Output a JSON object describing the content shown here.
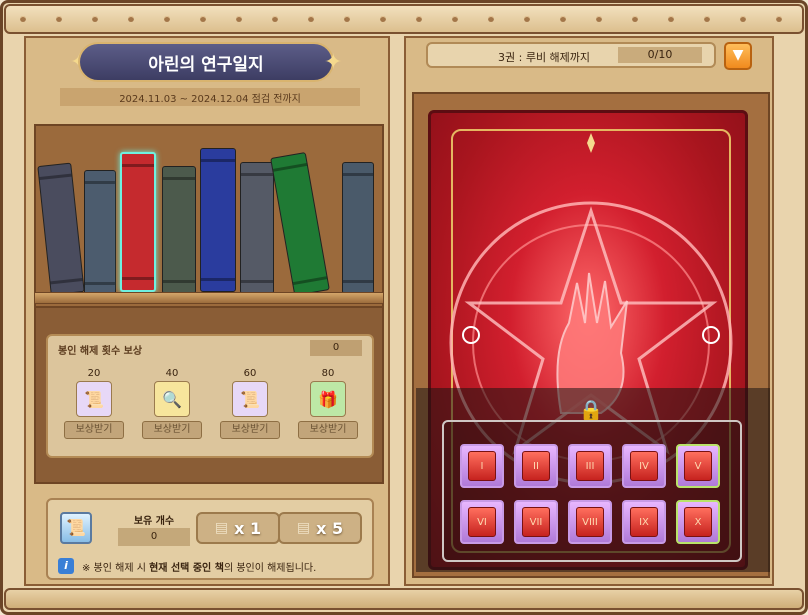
{
  "title": "아린의 연구일지",
  "period": "2024.11.03 ~ 2024.12.04 점검 전까지",
  "progress": {
    "label": "3권 : 루비 해제까지",
    "value": "0/10",
    "dropdown_icon": "chevron-down-icon"
  },
  "books": [
    {
      "color": "#4a4c5e",
      "selected": false
    },
    {
      "color": "#4c5c6e",
      "selected": false
    },
    {
      "color": "#c52a2e",
      "selected": true
    },
    {
      "color": "#4c5a4c",
      "selected": false
    },
    {
      "color": "#2a3c9e",
      "selected": false
    },
    {
      "color": "#555a66",
      "selected": false
    },
    {
      "color": "#1f7a34",
      "selected": false
    },
    {
      "color": "#4a5a6a",
      "selected": false
    }
  ],
  "rewards": {
    "heading": "봉인 해제 횟수 보상",
    "count": "0",
    "items": [
      {
        "threshold": "20",
        "button": "보상받기",
        "icon": "scroll-icon"
      },
      {
        "threshold": "40",
        "button": "보상받기",
        "icon": "magnifier-icon"
      },
      {
        "threshold": "60",
        "button": "보상받기",
        "icon": "scroll-icon"
      },
      {
        "threshold": "80",
        "button": "보상받기",
        "icon": "treasure-chest-icon"
      }
    ]
  },
  "holdings": {
    "label": "보유 개수",
    "value": "0",
    "use_x1": "x 1",
    "use_x5": "x 5"
  },
  "note": {
    "before": "※ 봉인 해제 시 ",
    "bold": "현재 선택 중인 책",
    "after": "의 봉인이 해제됩니다."
  },
  "grid": {
    "rows": 2,
    "cols": 5,
    "numerals": [
      "I",
      "II",
      "III",
      "IV",
      "V",
      "VI",
      "VII",
      "VIII",
      "IX",
      "X"
    ]
  },
  "colors": {
    "book_red": "#c52a2e",
    "accent_orange": "#f08a1e",
    "gold": "#e5b761"
  }
}
